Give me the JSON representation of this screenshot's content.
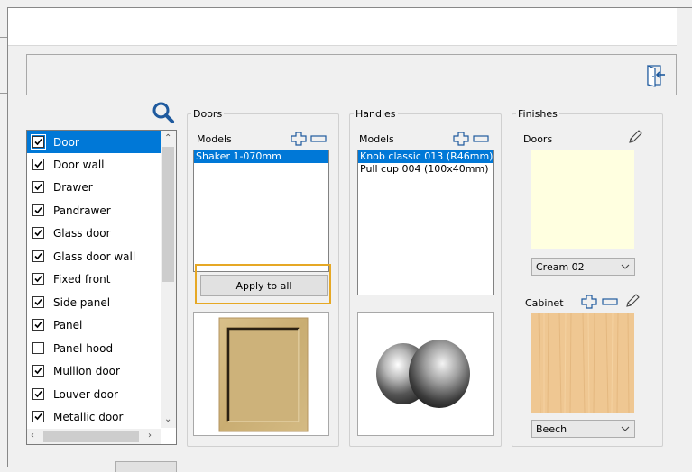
{
  "left_list": {
    "items": [
      {
        "label": "Door",
        "checked": true,
        "selected": true
      },
      {
        "label": "Door wall",
        "checked": true,
        "selected": false
      },
      {
        "label": "Drawer",
        "checked": true,
        "selected": false
      },
      {
        "label": "Pandrawer",
        "checked": true,
        "selected": false
      },
      {
        "label": "Glass door",
        "checked": true,
        "selected": false
      },
      {
        "label": "Glass door wall",
        "checked": true,
        "selected": false
      },
      {
        "label": "Fixed front",
        "checked": true,
        "selected": false
      },
      {
        "label": "Side panel",
        "checked": true,
        "selected": false
      },
      {
        "label": "Panel",
        "checked": true,
        "selected": false
      },
      {
        "label": "Panel hood",
        "checked": false,
        "selected": false
      },
      {
        "label": "Mullion door",
        "checked": true,
        "selected": false
      },
      {
        "label": "Louver door",
        "checked": true,
        "selected": false
      },
      {
        "label": "Metallic door",
        "checked": true,
        "selected": false
      }
    ]
  },
  "doors": {
    "title": "Doors",
    "models_label": "Models",
    "models": [
      {
        "label": "Shaker 1-070mm",
        "selected": true
      }
    ],
    "apply_label": "Apply to all"
  },
  "handles": {
    "title": "Handles",
    "models_label": "Models",
    "models": [
      {
        "label": "Knob classic 013 (R46mm)",
        "selected": true
      },
      {
        "label": "Pull cup 004 (100x40mm)",
        "selected": false
      }
    ]
  },
  "finishes": {
    "title": "Finishes",
    "doors_label": "Doors",
    "doors_color": "#ffffe0",
    "doors_value": "Cream 02",
    "cabinet_label": "Cabinet",
    "cabinet_color": "#f0c894",
    "cabinet_value": "Beech"
  },
  "colors": {
    "selection": "#0078d7",
    "highlight_border": "#e6a825",
    "icon_blue": "#1f5a9e"
  },
  "icons": [
    "exit-door-icon",
    "search-icon",
    "plus-icon",
    "minus-icon",
    "pencil-icon",
    "chevron-down-icon",
    "checkmark-icon"
  ]
}
